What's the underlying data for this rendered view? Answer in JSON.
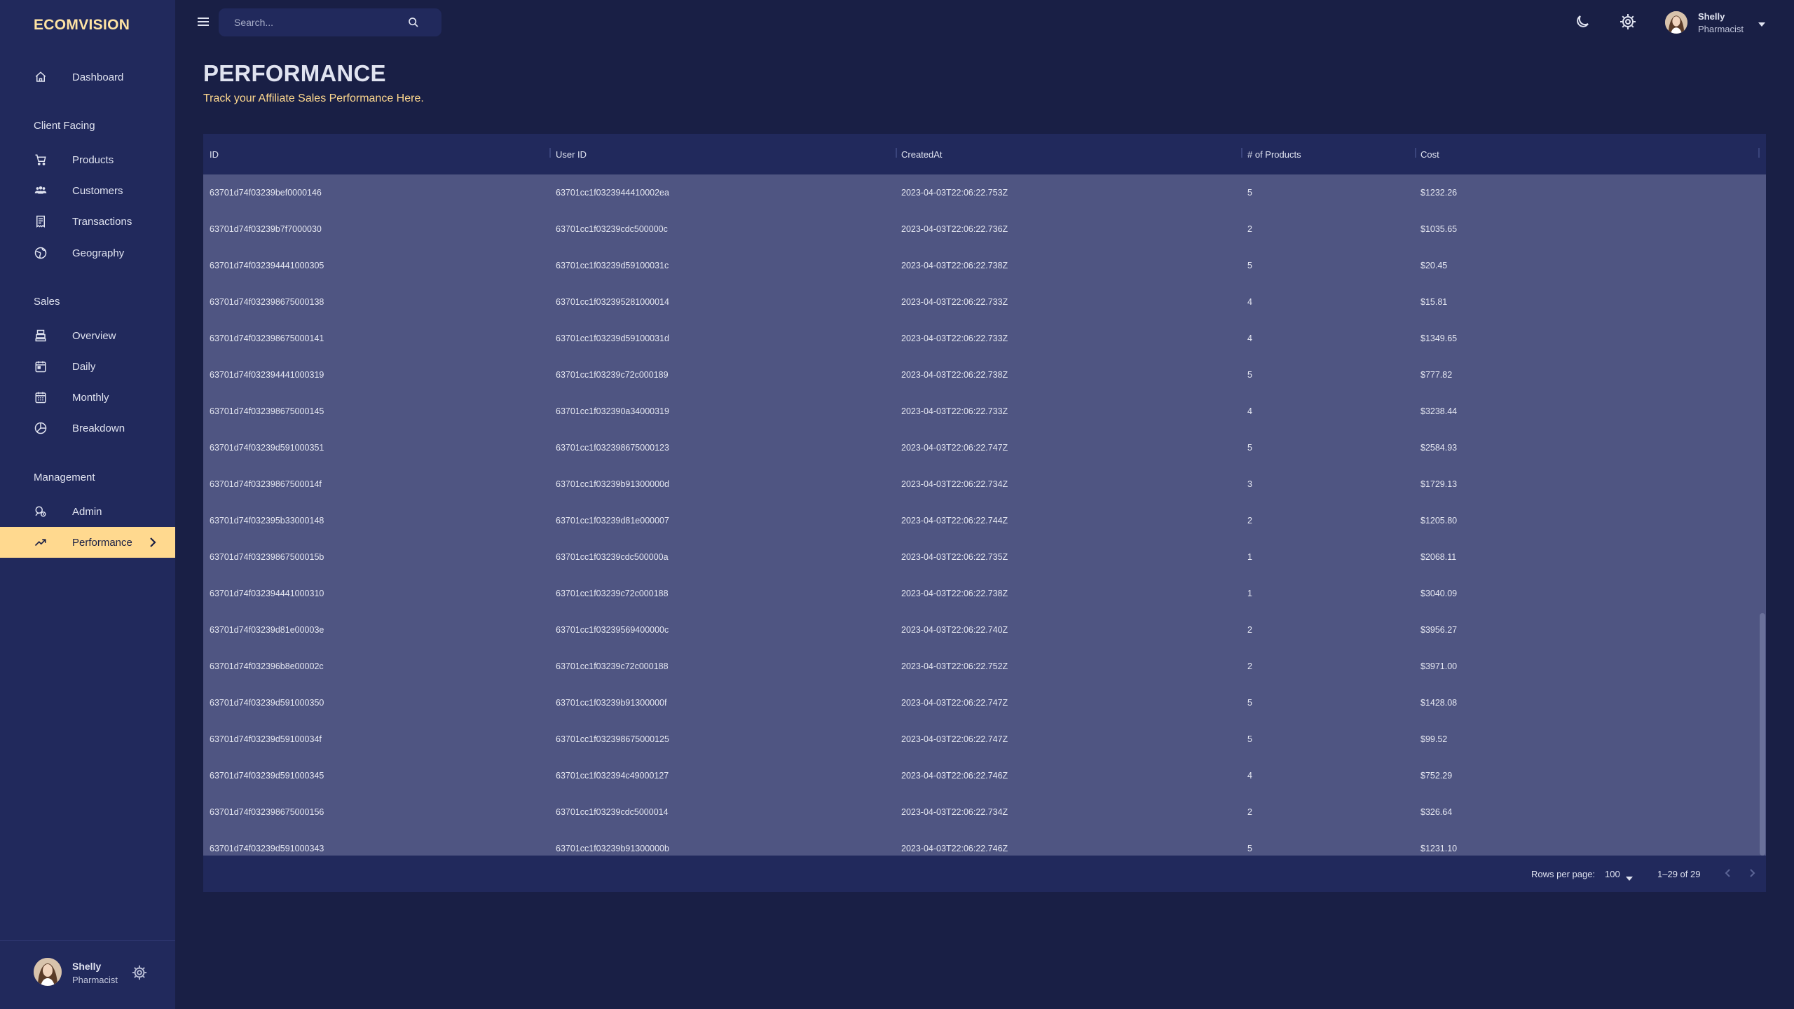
{
  "brand": "ECOMVISION",
  "sidebar": {
    "sections": [
      "Client Facing",
      "Sales",
      "Management"
    ],
    "items": [
      {
        "label": "Dashboard",
        "icon": "home-icon"
      },
      {
        "label": "Products",
        "icon": "shopping-cart-icon"
      },
      {
        "label": "Customers",
        "icon": "groups-icon"
      },
      {
        "label": "Transactions",
        "icon": "receipt-icon"
      },
      {
        "label": "Geography",
        "icon": "globe-icon"
      },
      {
        "label": "Overview",
        "icon": "point-of-sale-icon"
      },
      {
        "label": "Daily",
        "icon": "calendar-today-icon"
      },
      {
        "label": "Monthly",
        "icon": "calendar-month-icon"
      },
      {
        "label": "Breakdown",
        "icon": "pie-chart-icon"
      },
      {
        "label": "Admin",
        "icon": "admin-icon"
      },
      {
        "label": "Performance",
        "icon": "trending-up-icon",
        "active": true
      }
    ],
    "user": {
      "name": "Shelly",
      "role": "Pharmacist"
    }
  },
  "topbar": {
    "search_placeholder": "Search...",
    "user": {
      "name": "Shelly",
      "role": "Pharmacist"
    }
  },
  "header": {
    "title": "PERFORMANCE",
    "subtitle": "Track your Affiliate Sales Performance Here."
  },
  "table": {
    "columns": [
      "ID",
      "User ID",
      "CreatedAt",
      "# of Products",
      "Cost"
    ],
    "rows": [
      [
        "63701d74f03239bef0000146",
        "63701cc1f0323944410002ea",
        "2023-04-03T22:06:22.753Z",
        "5",
        "$1232.26"
      ],
      [
        "63701d74f03239b7f7000030",
        "63701cc1f03239cdc500000c",
        "2023-04-03T22:06:22.736Z",
        "2",
        "$1035.65"
      ],
      [
        "63701d74f032394441000305",
        "63701cc1f03239d59100031c",
        "2023-04-03T22:06:22.738Z",
        "5",
        "$20.45"
      ],
      [
        "63701d74f032398675000138",
        "63701cc1f032395281000014",
        "2023-04-03T22:06:22.733Z",
        "4",
        "$15.81"
      ],
      [
        "63701d74f032398675000141",
        "63701cc1f03239d59100031d",
        "2023-04-03T22:06:22.733Z",
        "4",
        "$1349.65"
      ],
      [
        "63701d74f032394441000319",
        "63701cc1f03239c72c000189",
        "2023-04-03T22:06:22.738Z",
        "5",
        "$777.82"
      ],
      [
        "63701d74f032398675000145",
        "63701cc1f032390a34000319",
        "2023-04-03T22:06:22.733Z",
        "4",
        "$3238.44"
      ],
      [
        "63701d74f03239d591000351",
        "63701cc1f032398675000123",
        "2023-04-03T22:06:22.747Z",
        "5",
        "$2584.93"
      ],
      [
        "63701d74f03239867500014f",
        "63701cc1f03239b91300000d",
        "2023-04-03T22:06:22.734Z",
        "3",
        "$1729.13"
      ],
      [
        "63701d74f032395b33000148",
        "63701cc1f03239d81e000007",
        "2023-04-03T22:06:22.744Z",
        "2",
        "$1205.80"
      ],
      [
        "63701d74f03239867500015b",
        "63701cc1f03239cdc500000a",
        "2023-04-03T22:06:22.735Z",
        "1",
        "$2068.11"
      ],
      [
        "63701d74f032394441000310",
        "63701cc1f03239c72c000188",
        "2023-04-03T22:06:22.738Z",
        "1",
        "$3040.09"
      ],
      [
        "63701d74f03239d81e00003e",
        "63701cc1f03239569400000c",
        "2023-04-03T22:06:22.740Z",
        "2",
        "$3956.27"
      ],
      [
        "63701d74f032396b8e00002c",
        "63701cc1f03239c72c000188",
        "2023-04-03T22:06:22.752Z",
        "2",
        "$3971.00"
      ],
      [
        "63701d74f03239d591000350",
        "63701cc1f03239b91300000f",
        "2023-04-03T22:06:22.747Z",
        "5",
        "$1428.08"
      ],
      [
        "63701d74f03239d59100034f",
        "63701cc1f032398675000125",
        "2023-04-03T22:06:22.747Z",
        "5",
        "$99.52"
      ],
      [
        "63701d74f03239d591000345",
        "63701cc1f032394c49000127",
        "2023-04-03T22:06:22.746Z",
        "4",
        "$752.29"
      ],
      [
        "63701d74f032398675000156",
        "63701cc1f03239cdc5000014",
        "2023-04-03T22:06:22.734Z",
        "2",
        "$326.64"
      ],
      [
        "63701d74f03239d591000343",
        "63701cc1f03239b91300000b",
        "2023-04-03T22:06:22.746Z",
        "5",
        "$1231.10"
      ]
    ],
    "footer": {
      "rows_per_page_label": "Rows per page:",
      "rows_per_page": "100",
      "range": "1–29 of 29"
    }
  },
  "colors": {
    "background": "#191f45",
    "sidebar": "#21295c",
    "accent": "#ffd98f",
    "brand": "#ffe3a3",
    "table_body": "#4f5582"
  }
}
